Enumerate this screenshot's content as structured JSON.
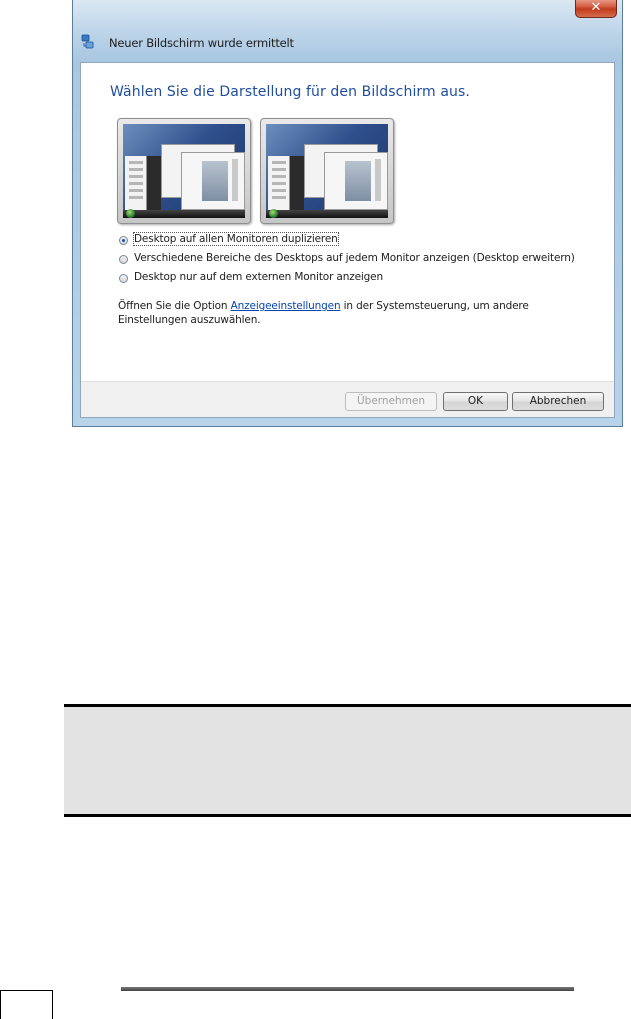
{
  "window": {
    "title": "Neuer Bildschirm wurde ermittelt",
    "close_label": "✕"
  },
  "dialog": {
    "heading": "Wählen Sie die Darstellung für den Bildschirm aus.",
    "options": [
      {
        "label": "Desktop auf allen Monitoren duplizieren",
        "checked": true
      },
      {
        "label": "Verschiedene Bereiche des Desktops auf jedem Monitor anzeigen (Desktop erweitern)",
        "checked": false
      },
      {
        "label": "Desktop nur auf dem externen Monitor anzeigen",
        "checked": false
      }
    ],
    "info_prefix": "Öffnen Sie die Option ",
    "info_link": "Anzeigeeinstellungen",
    "info_suffix": " in der Systemsteuerung, um andere Einstellungen auszuwählen."
  },
  "buttons": {
    "apply": "Übernehmen",
    "ok": "OK",
    "cancel": "Abbrechen"
  }
}
